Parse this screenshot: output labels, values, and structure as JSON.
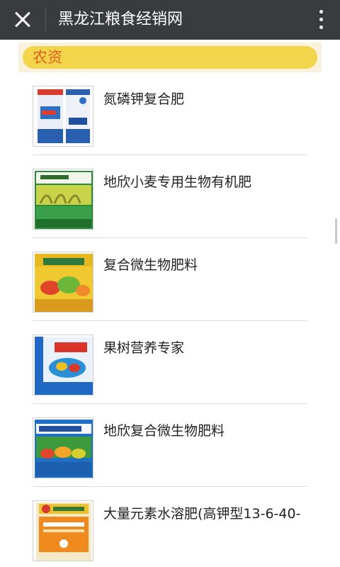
{
  "header": {
    "title": "黑龙江粮食经销网"
  },
  "section": {
    "label": "农资"
  },
  "products": [
    {
      "title": "氮磷钾复合肥"
    },
    {
      "title": "地欣小麦专用生物有机肥"
    },
    {
      "title": "复合微生物肥料"
    },
    {
      "title": "果树营养专家"
    },
    {
      "title": "地欣复合微生物肥料"
    },
    {
      "title": "大量元素水溶肥(高钾型13-6-40-"
    }
  ],
  "colors": {
    "topbar": "#3a3b3f",
    "section_pill": "#f3d54b",
    "section_text": "#e0611f"
  },
  "icons": {
    "close": "close-icon",
    "more": "more-vertical-icon"
  }
}
